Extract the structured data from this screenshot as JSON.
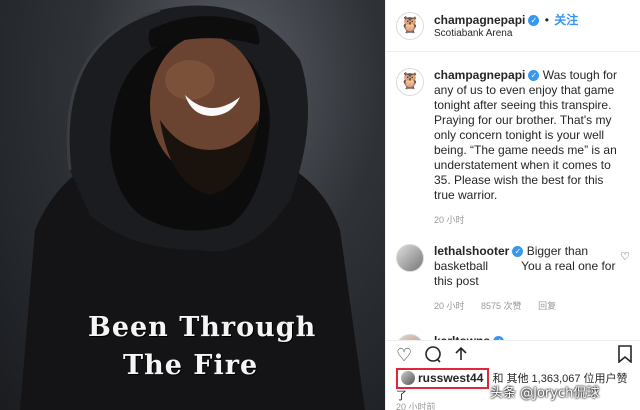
{
  "post_author": {
    "username": "champagnepapi",
    "follow_label": "关注",
    "location": "Scotiabank Arena",
    "icon": "owl-logo-icon"
  },
  "shirt_text": {
    "line1": "Been Through",
    "line2": "The Fire"
  },
  "caption": {
    "username": "champagnepapi",
    "text": "Was tough for any of us to even enjoy that game tonight after seeing this transpire. Praying for our brother. That's my only concern tonight is your well being. “The game needs me” is an understatement when it comes to 35. Please wish the best for this true warrior.",
    "time": "20 小时"
  },
  "comments": [
    {
      "username": "lethalshooter",
      "text": "Bigger than basketball          You a real one for this post",
      "time": "20 小时",
      "likes": "8575 次赞",
      "reply": "回复"
    },
    {
      "username": "karltowns"
    }
  ],
  "likes_line": {
    "highlighted_user": "russwest44",
    "rest": "和 其他 1,363,067 位用户赞了"
  },
  "post_time": "20 小时前",
  "watermark": "头条 @Jorych侃球",
  "icons": {
    "heart": "heart-icon",
    "comment": "comment-icon",
    "share": "share-icon",
    "bookmark": "bookmark-icon"
  },
  "colors": {
    "verified": "#3897f0",
    "highlight_box": "#e0263a"
  }
}
